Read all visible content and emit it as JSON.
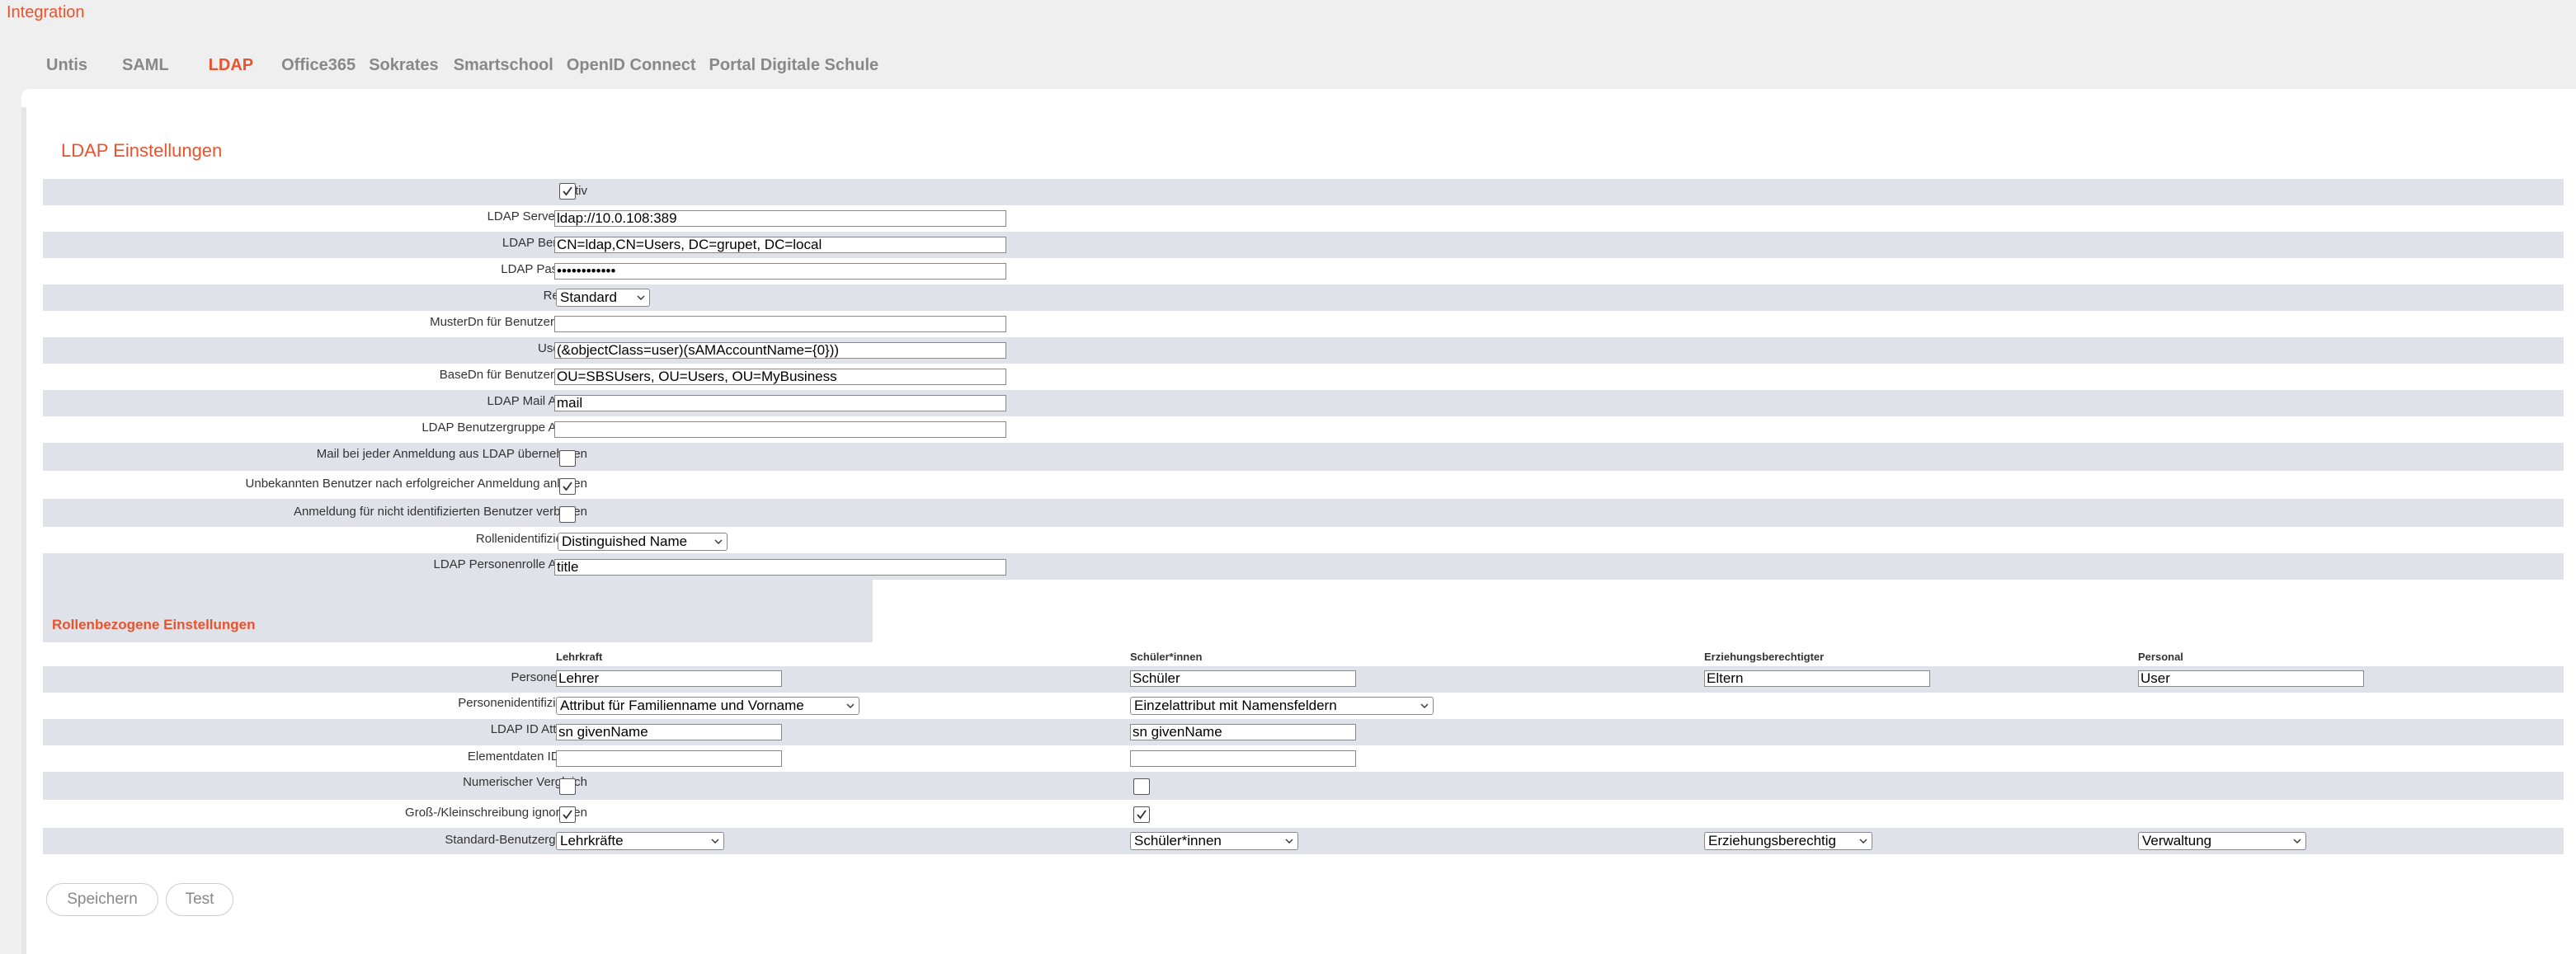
{
  "app_title": "Integration",
  "tabs": [
    {
      "label": "Untis"
    },
    {
      "label": "SAML"
    },
    {
      "label": "LDAP"
    },
    {
      "label": "Office365"
    },
    {
      "label": "Sokrates"
    },
    {
      "label": "Smartschool"
    },
    {
      "label": "OpenID Connect"
    },
    {
      "label": "Portal Digitale Schule"
    }
  ],
  "active_tab": "LDAP",
  "section_title": "LDAP Einstellungen",
  "ldap": {
    "aktiv_label": "aktiv",
    "aktiv_checked": true,
    "server_url_label": "LDAP Server URL",
    "server_url": "ldap://10.0.108:389",
    "benutzer_label": "LDAP Benutzer",
    "benutzer": "CN=ldap,CN=Users, DC=grupet, DC=local",
    "passwort_label": "LDAP Passwort",
    "passwort": "••••••••••••",
    "referral_label": "Referral",
    "referral": "Standard",
    "musterdn_label": "MusterDn für Benutzersuche",
    "musterdn": "",
    "userfilter_label": "Userfilter",
    "userfilter": "(&objectClass=user)(sAMAccountName={0}))",
    "basedn_label": "BaseDn für Benutzersuche",
    "basedn": "OU=SBSUsers, OU=Users, OU=MyBusiness",
    "mail_attr_label": "LDAP Mail Attribut",
    "mail_attr": "mail",
    "gruppe_attr_label": "LDAP Benutzergruppe Attribut",
    "gruppe_attr": "",
    "mail_uebernehmen_label": "Mail bei jeder Anmeldung aus LDAP übernehmen",
    "mail_uebernehmen_checked": false,
    "unbekannte_anlegen_label": "Unbekannten Benutzer nach erfolgreicher Anmeldung anlegen",
    "unbekannte_anlegen_checked": true,
    "anmeldung_verbieten_label": "Anmeldung für nicht identifizierten Benutzer verbieten",
    "anmeldung_verbieten_checked": false,
    "rollenident_label": "Rollenidentifizierung",
    "rollenident": "Distinguished Name",
    "personenrolle_attr_label": "LDAP Personenrolle Attribut",
    "personenrolle_attr": "title"
  },
  "roles": {
    "title": "Rollenbezogene Einstellungen",
    "columns": [
      "Lehrkraft",
      "Schüler*innen",
      "Erziehungsberechtigter",
      "Personal"
    ],
    "personenrolle_label": "Personenrolle",
    "personenrolle": [
      "Lehrer",
      "Schüler",
      "Eltern",
      "User"
    ],
    "personenident_label": "Personenidentifizierung",
    "personenident": [
      "Attribut für Familienname und Vorname",
      "Einzelattribut mit Namensfeldern"
    ],
    "ldap_id_label": "LDAP ID Attribute",
    "ldap_id": [
      "sn givenName",
      "sn givenName"
    ],
    "elementdaten_label": "Elementdaten ID Feld",
    "elementdaten": [
      "",
      ""
    ],
    "numerisch_label": "Numerischer Vergleich",
    "numerisch_checked": [
      false,
      false
    ],
    "gross_klein_label": "Groß-/Kleinschreibung ignorieren",
    "gross_klein_checked": [
      true,
      true
    ],
    "standard_gruppe_label": "Standard-Benutzergruppe",
    "standard_gruppe": [
      "Lehrkräfte",
      "Schüler*innen",
      "Erziehungsberechtig",
      "Verwaltung"
    ]
  },
  "buttons": {
    "save": "Speichern",
    "test": "Test"
  }
}
